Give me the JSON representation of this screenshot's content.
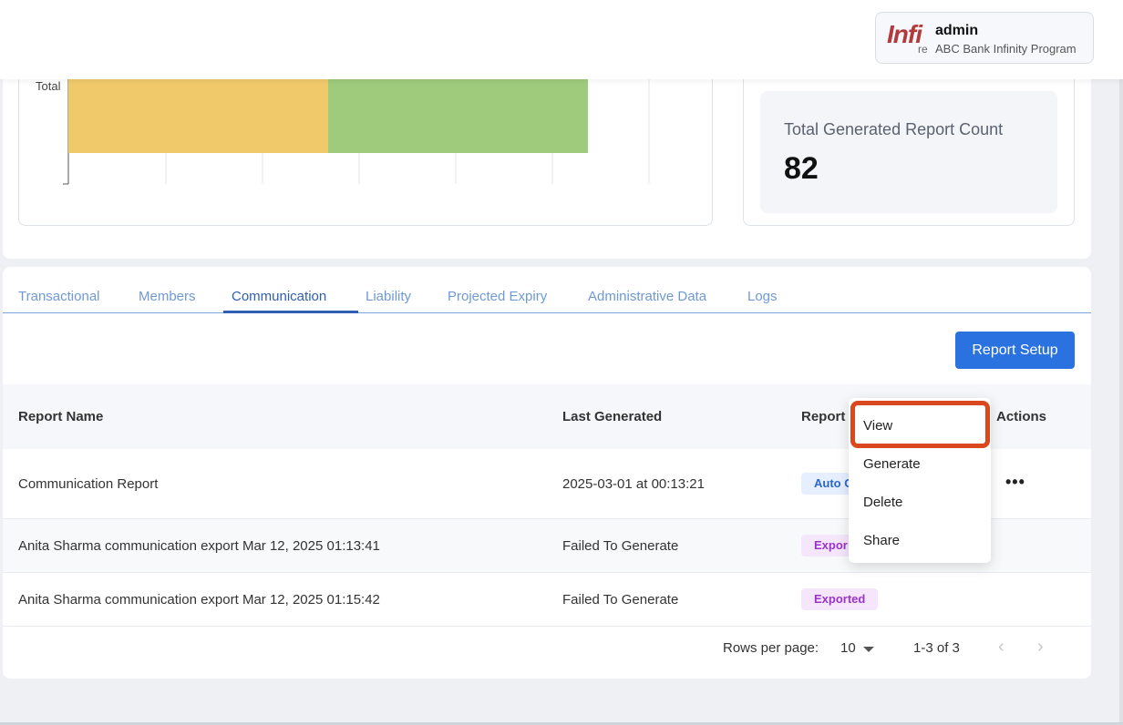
{
  "header": {
    "logo_text": "Infi",
    "logo_sub": "re",
    "user_name": "admin",
    "program": "ABC Bank Infinity Program"
  },
  "chart_data": {
    "type": "bar",
    "orientation": "horizontal-stacked",
    "categories": [
      "Total"
    ],
    "series": [
      {
        "values": [
          1
        ],
        "color": "#f0c96b"
      },
      {
        "values": [
          1
        ],
        "color": "#9ecb7c"
      }
    ],
    "tick_labels_visible": [
      "Total"
    ],
    "grid": true
  },
  "stat": {
    "label": "Total Generated Report Count",
    "value": "82"
  },
  "tabs": [
    {
      "label": "Transactional",
      "active": false
    },
    {
      "label": "Members",
      "active": false
    },
    {
      "label": "Communication",
      "active": true
    },
    {
      "label": "Liability",
      "active": false
    },
    {
      "label": "Projected Expiry",
      "active": false
    },
    {
      "label": "Administrative Data",
      "active": false
    },
    {
      "label": "Logs",
      "active": false
    }
  ],
  "toolbar": {
    "report_setup_label": "Report Setup"
  },
  "table": {
    "headers": {
      "report_name": "Report Name",
      "last_generated": "Last Generated",
      "report_type": "Report",
      "actions": "Actions"
    },
    "rows": [
      {
        "name": "Communication Report",
        "last_generated": "2025-03-01 at 00:13:21",
        "badge": "Auto G",
        "actions": "•••"
      },
      {
        "name": "Anita Sharma communication export Mar 12, 2025 01:13:41",
        "last_generated": "Failed To Generate",
        "badge": "Expor",
        "actions": ""
      },
      {
        "name": "Anita Sharma communication export Mar 12, 2025 01:15:42",
        "last_generated": "Failed To Generate",
        "badge": "Exported",
        "actions": ""
      }
    ]
  },
  "pagination": {
    "rows_per_page_label": "Rows per page:",
    "rows_per_page_value": "10",
    "range": "1-3 of 3",
    "prev": "‹",
    "next": "›"
  },
  "menu": {
    "items": [
      "View",
      "Generate",
      "Delete",
      "Share"
    ]
  },
  "colors": {
    "accent": "#2a72e0",
    "highlight": "#d9481f"
  }
}
